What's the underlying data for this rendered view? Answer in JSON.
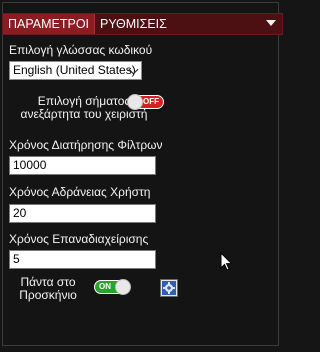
{
  "tabs": [
    {
      "label": "ΠΑΡΑΜΕΤΡΟΙ",
      "active": true
    },
    {
      "label": "ΡΥΘΜΙΣΕΙΣ",
      "active": false
    }
  ],
  "language": {
    "label": "Επιλογή γλώσσας κωδικού",
    "selected": "English (United States)"
  },
  "signal_toggle": {
    "label_line1": "Επιλογή σήματος",
    "label_line2": "ανεξάρτητα του χειριστή",
    "state": "off",
    "state_text": "OFF"
  },
  "filter_retention": {
    "label": "Χρόνος Διατήρησης Φίλτρων",
    "value": "10000"
  },
  "user_idle": {
    "label": "Χρόνος Αδράνειας Χρήστη",
    "value": "20"
  },
  "retry_time": {
    "label": "Χρόνος Επαναδιαχείρισης",
    "value": "5"
  },
  "always_on_top": {
    "label_line1": "Πάντα στο",
    "label_line2": "Προσκήνιο",
    "state": "on",
    "state_text": "ON"
  },
  "colors": {
    "background": "#151515",
    "tabbar": "#4c0f12",
    "active_tab": "#8a1c22",
    "toggle_off": "#d42121",
    "toggle_on": "#27a52b"
  },
  "icons": [
    "dropdown-arrow-icon",
    "settings-gear-icon",
    "mouse-pointer-icon"
  ]
}
